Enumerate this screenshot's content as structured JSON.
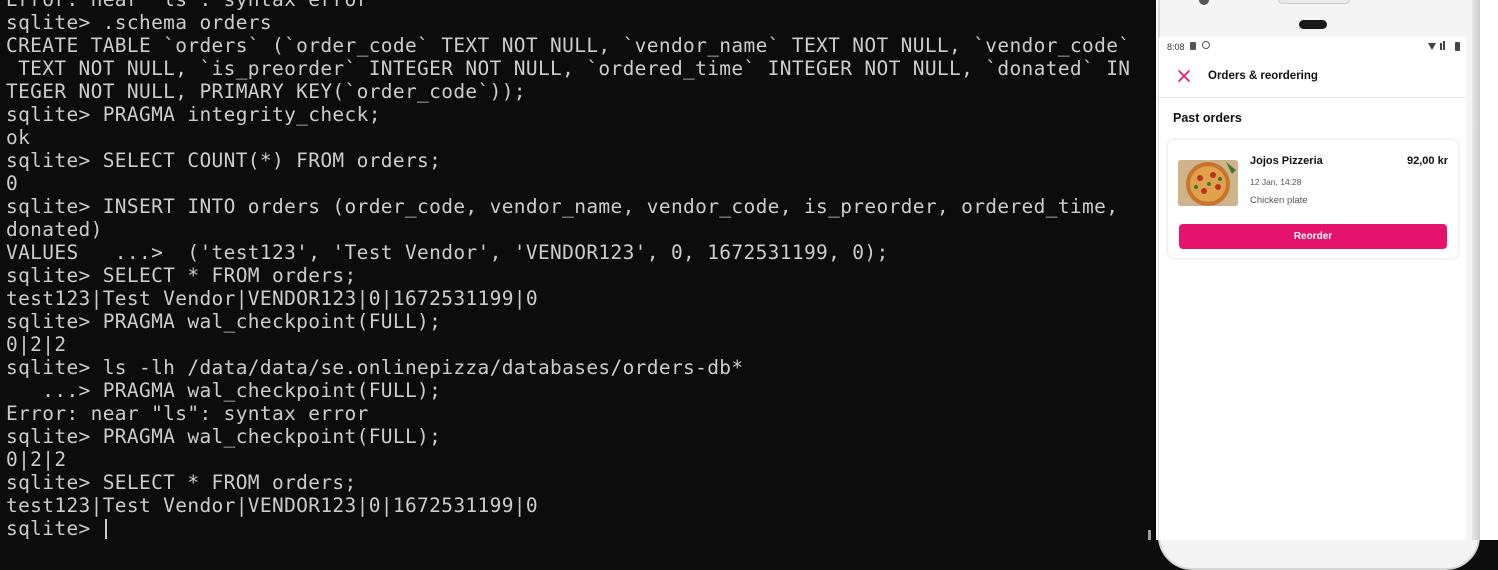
{
  "terminal": {
    "lines": [
      "Error: near \"ls\": syntax error",
      "sqlite> .schema orders",
      "CREATE TABLE `orders` (`order_code` TEXT NOT NULL, `vendor_name` TEXT NOT NULL, `vendor_code`",
      " TEXT NOT NULL, `is_preorder` INTEGER NOT NULL, `ordered_time` INTEGER NOT NULL, `donated` IN",
      "TEGER NOT NULL, PRIMARY KEY(`order_code`));",
      "sqlite> PRAGMA integrity_check;",
      "ok",
      "sqlite> SELECT COUNT(*) FROM orders;",
      "0",
      "sqlite> INSERT INTO orders (order_code, vendor_name, vendor_code, is_preorder, ordered_time,",
      "donated)",
      "VALUES   ...>  ('test123', 'Test Vendor', 'VENDOR123', 0, 1672531199, 0);",
      "sqlite> SELECT * FROM orders;",
      "test123|Test Vendor|VENDOR123|0|1672531199|0",
      "sqlite> PRAGMA wal_checkpoint(FULL);",
      "0|2|2",
      "sqlite> ls -lh /data/data/se.onlinepizza/databases/orders-db*",
      "   ...> PRAGMA wal_checkpoint(FULL);",
      "Error: near \"ls\": syntax error",
      "sqlite> PRAGMA wal_checkpoint(FULL);",
      "0|2|2",
      "sqlite> SELECT * FROM orders;",
      "test123|Test Vendor|VENDOR123|0|1672531199|0"
    ],
    "prompt": "sqlite> "
  },
  "phone": {
    "status_time": "8:08",
    "app_bar_title": "Orders & reordering",
    "section_title": "Past orders",
    "order": {
      "vendor": "Jojos Pizzeria",
      "price": "92,00 kr",
      "date": "12 Jan, 14:28",
      "item": "Chicken plate",
      "reorder_label": "Reorder"
    }
  },
  "colors": {
    "terminal_bg": "#0c0c0c",
    "terminal_text": "#cccccc",
    "accent": "#e4136c"
  },
  "icons": [
    "close-icon",
    "wifi-icon",
    "battery-icon",
    "camera-dot-icon"
  ]
}
